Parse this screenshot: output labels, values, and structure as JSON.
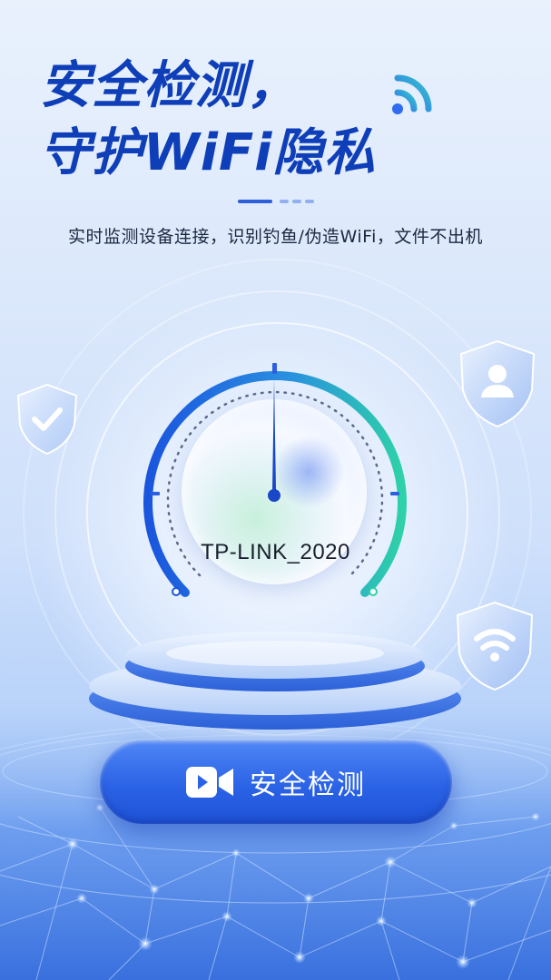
{
  "hero": {
    "title_line1": "安全检测，",
    "title_line2": "守护WiFi隐私",
    "subtitle": "实时监测设备连接，识别钓鱼/伪造WiFi，文件不出机"
  },
  "gauge": {
    "network_name": "TP-LINK_2020"
  },
  "action": {
    "button_label": "安全检测",
    "button_icon": "video-camera-icon"
  },
  "icons": {
    "top_decoration": "wifi-signal-icon",
    "left_shield": "shield-check-icon",
    "right_top_shield": "shield-user-icon",
    "right_bottom_shield": "shield-wifi-icon"
  },
  "colors": {
    "title": "#0f3fb8",
    "primary_button": "#2b63e6",
    "gauge_start": "#1a5be0",
    "gauge_end": "#2ed1a8",
    "background_top": "#e9f1fd"
  }
}
